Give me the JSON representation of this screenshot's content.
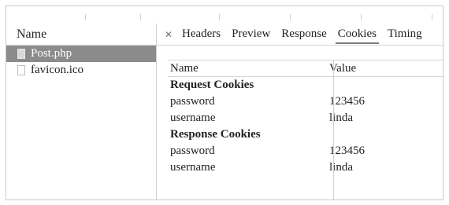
{
  "left_panel": {
    "header": "Name",
    "files": [
      {
        "name": "Post.php",
        "selected": true
      },
      {
        "name": "favicon.ico",
        "selected": false
      }
    ]
  },
  "tabs": {
    "close_icon": "close-icon",
    "items": [
      "Headers",
      "Preview",
      "Response",
      "Cookies",
      "Timing"
    ],
    "active": "Cookies"
  },
  "cookies_table": {
    "columns": [
      "Name",
      "Value"
    ],
    "request_section": "Request Cookies",
    "request_cookies": [
      {
        "name": "password",
        "value": "123456"
      },
      {
        "name": "username",
        "value": "linda"
      }
    ],
    "response_section": "Response Cookies",
    "response_cookies": [
      {
        "name": "password",
        "value": "123456"
      },
      {
        "name": "username",
        "value": "linda"
      }
    ]
  }
}
